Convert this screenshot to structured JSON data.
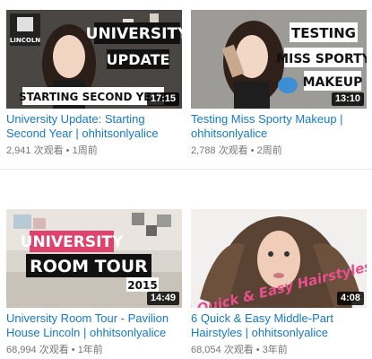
{
  "videos": [
    {
      "title": "University Update: Starting Second Year | ohhitsonlyalice",
      "views": "2,941 次观看",
      "sep": "•",
      "age": "1周前",
      "duration": "17:15",
      "thumb_text": [
        "UNIVERSITY",
        "UPDATE",
        "STARTING SECOND YEAR"
      ],
      "logo_text": "LINCOLN"
    },
    {
      "title": "Testing Miss Sporty Makeup | ohhitsonlyalice",
      "views": "2,788 次观看",
      "sep": "•",
      "age": "2周前",
      "duration": "13:10",
      "thumb_text": [
        "TESTING",
        "MISS SPORTY",
        "MAKEUP"
      ]
    },
    {
      "title": "University Room Tour - Pavilion House Lincoln | ohhitsonlyalice",
      "views": "68,994 次观看",
      "sep": "•",
      "age": "1年前",
      "duration": "14:49",
      "thumb_text": [
        "UNIVERSITY",
        "ROOM TOUR",
        "2015"
      ]
    },
    {
      "title": "6 Quick & Easy Middle-Part Hairstyles | ohhitsonlyalice",
      "views": "68,054 次观看",
      "sep": "•",
      "age": "3年前",
      "duration": "4:08",
      "thumb_text": [
        "6 Quick & Easy Hairstyles"
      ]
    }
  ],
  "colors": {
    "link": "#167ac6",
    "meta": "#767676",
    "duration_bg": "#000000"
  }
}
